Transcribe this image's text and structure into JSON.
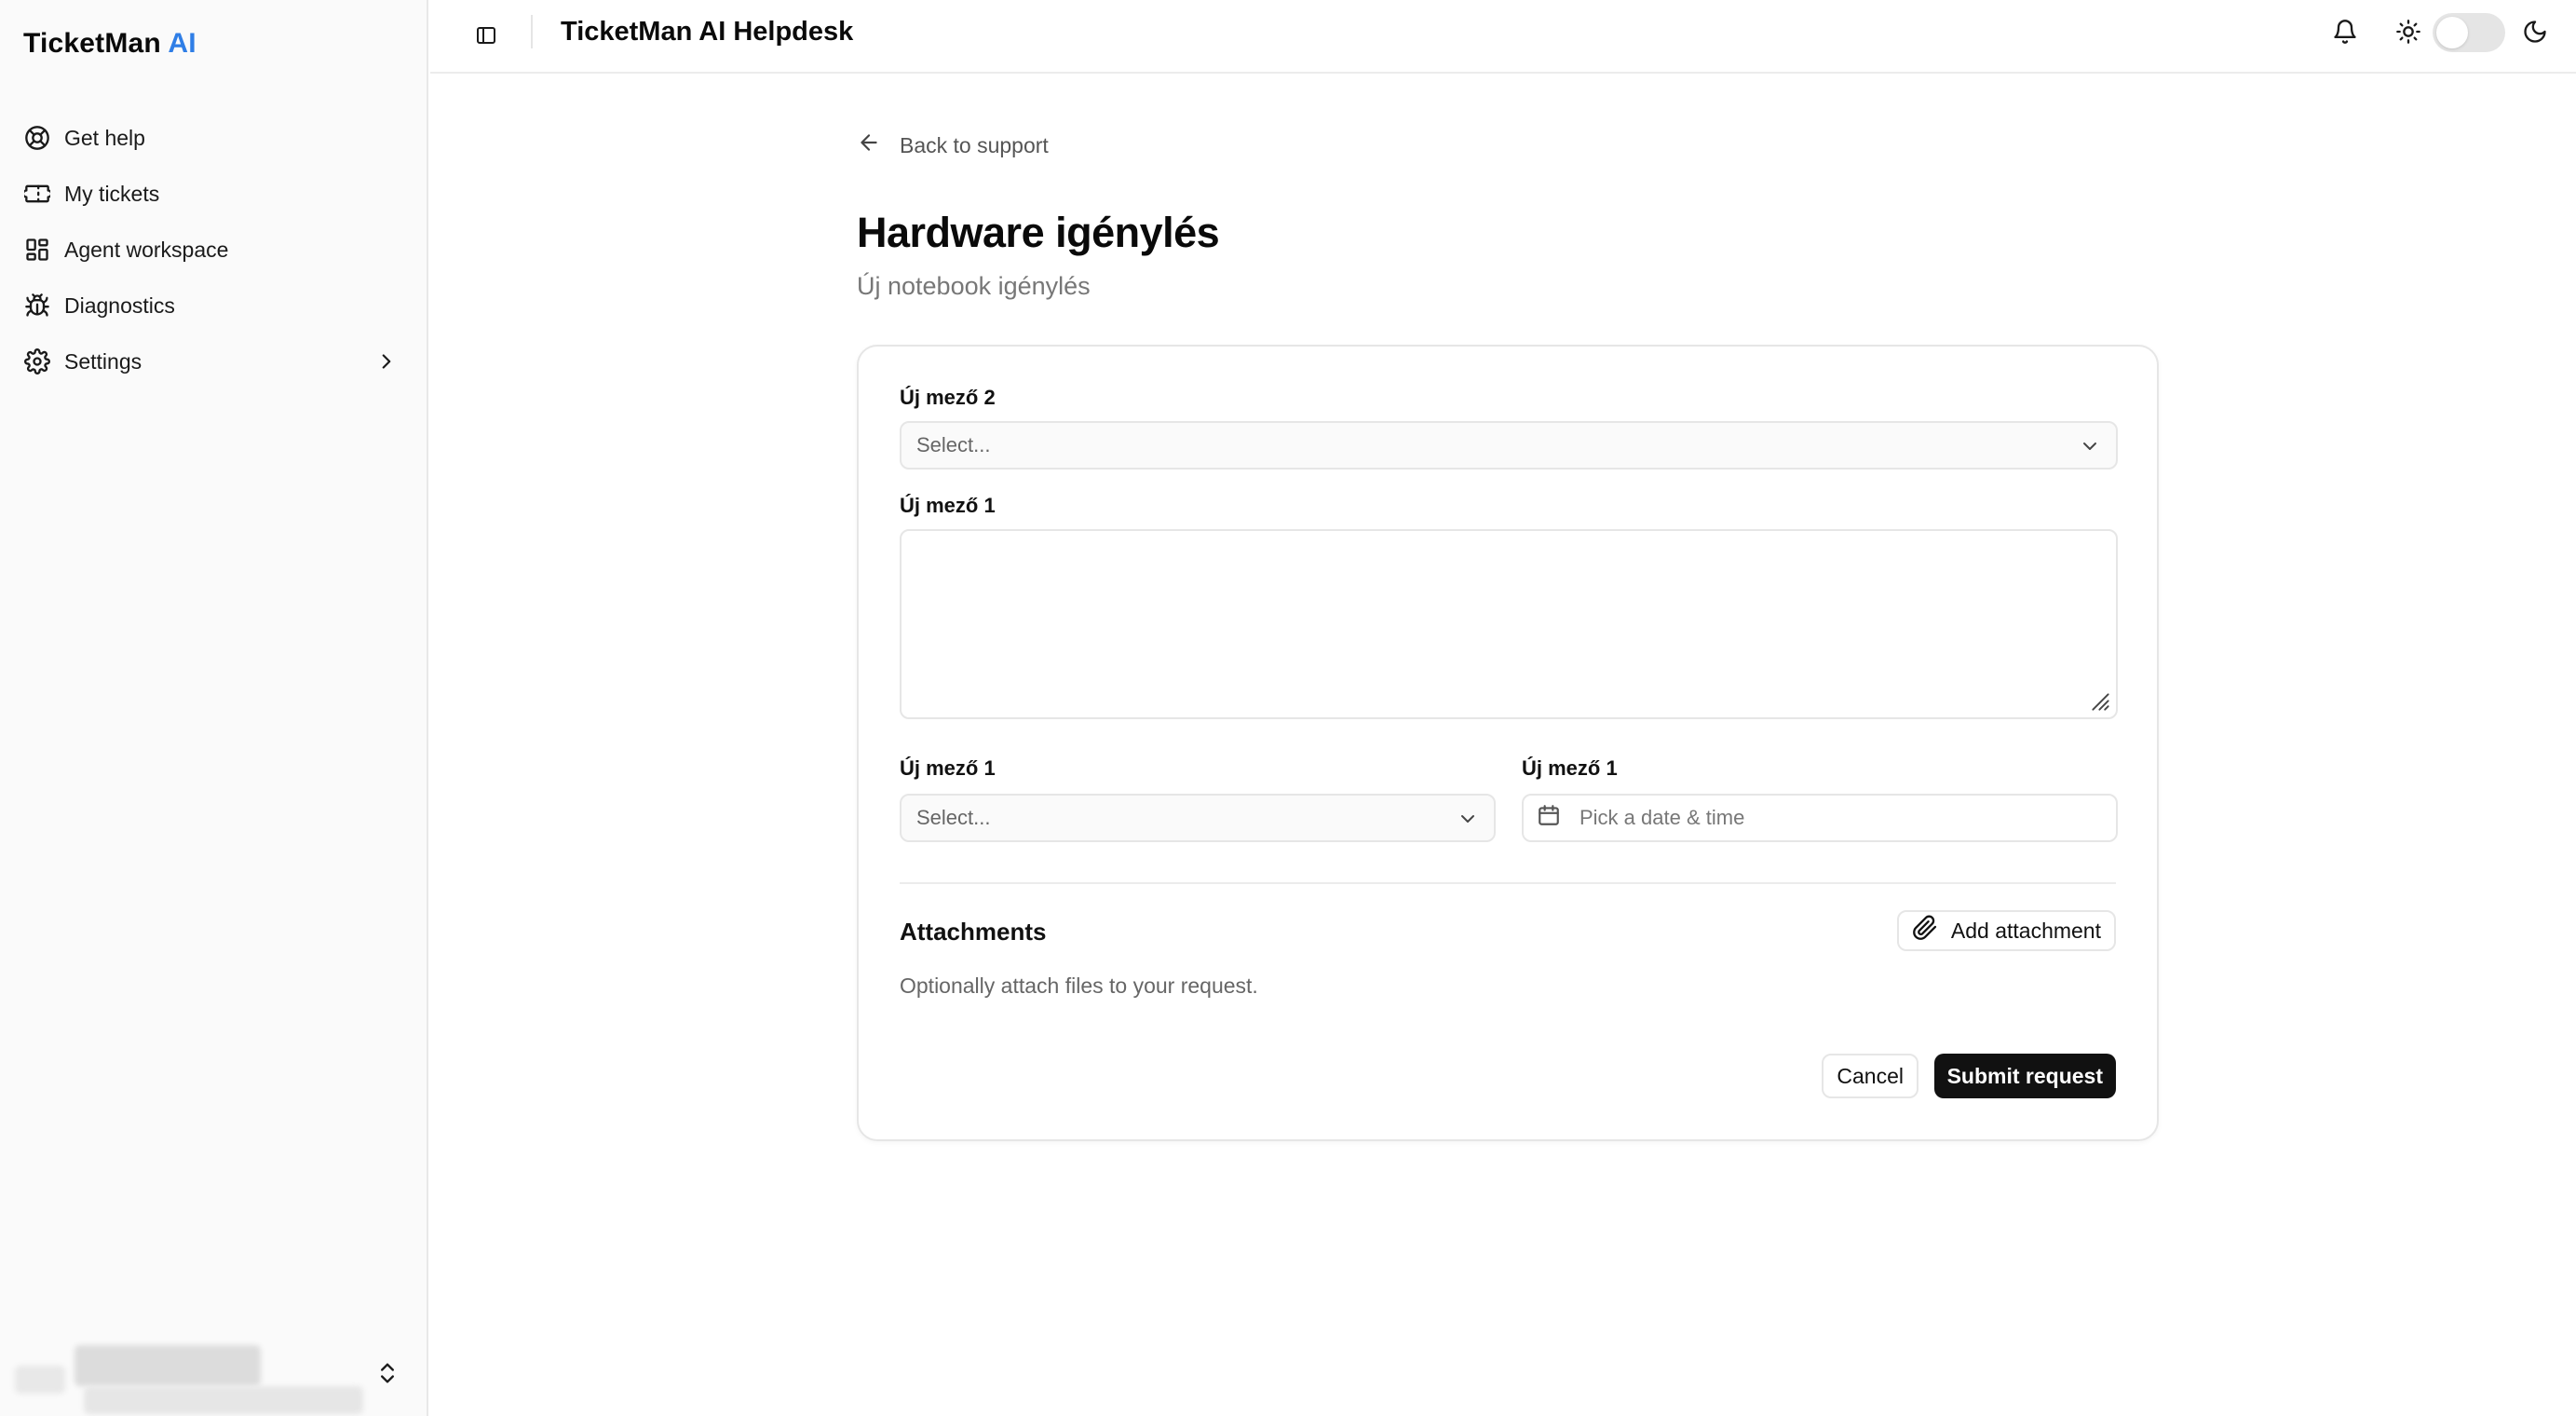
{
  "app": {
    "brand_name": "TicketMan",
    "brand_accent": "AI",
    "accent_color": "#2f7ee6",
    "header_title": "TicketMan AI Helpdesk"
  },
  "sidebar": {
    "items": [
      {
        "label": "Get help",
        "icon": "lifebuoy-icon"
      },
      {
        "label": "My tickets",
        "icon": "ticket-icon"
      },
      {
        "label": "Agent workspace",
        "icon": "layout-grid-icon"
      },
      {
        "label": "Diagnostics",
        "icon": "bug-icon"
      },
      {
        "label": "Settings",
        "icon": "gear-icon"
      }
    ]
  },
  "main": {
    "back_label": "Back to support",
    "title": "Hardware igénylés",
    "subtitle": "Új notebook igénylés"
  },
  "form": {
    "field1_label": "Új mező 2",
    "field1_placeholder": "Select...",
    "field2_label": "Új mező 1",
    "field3_label": "Új mező 1",
    "field3_placeholder": "Select...",
    "field4_label": "Új mező 1",
    "field4_placeholder": "Pick a date & time",
    "attachments_title": "Attachments",
    "attachments_hint": "Optionally attach files to your request.",
    "add_attachment_label": "Add attachment",
    "cancel_label": "Cancel",
    "submit_label": "Submit request"
  }
}
